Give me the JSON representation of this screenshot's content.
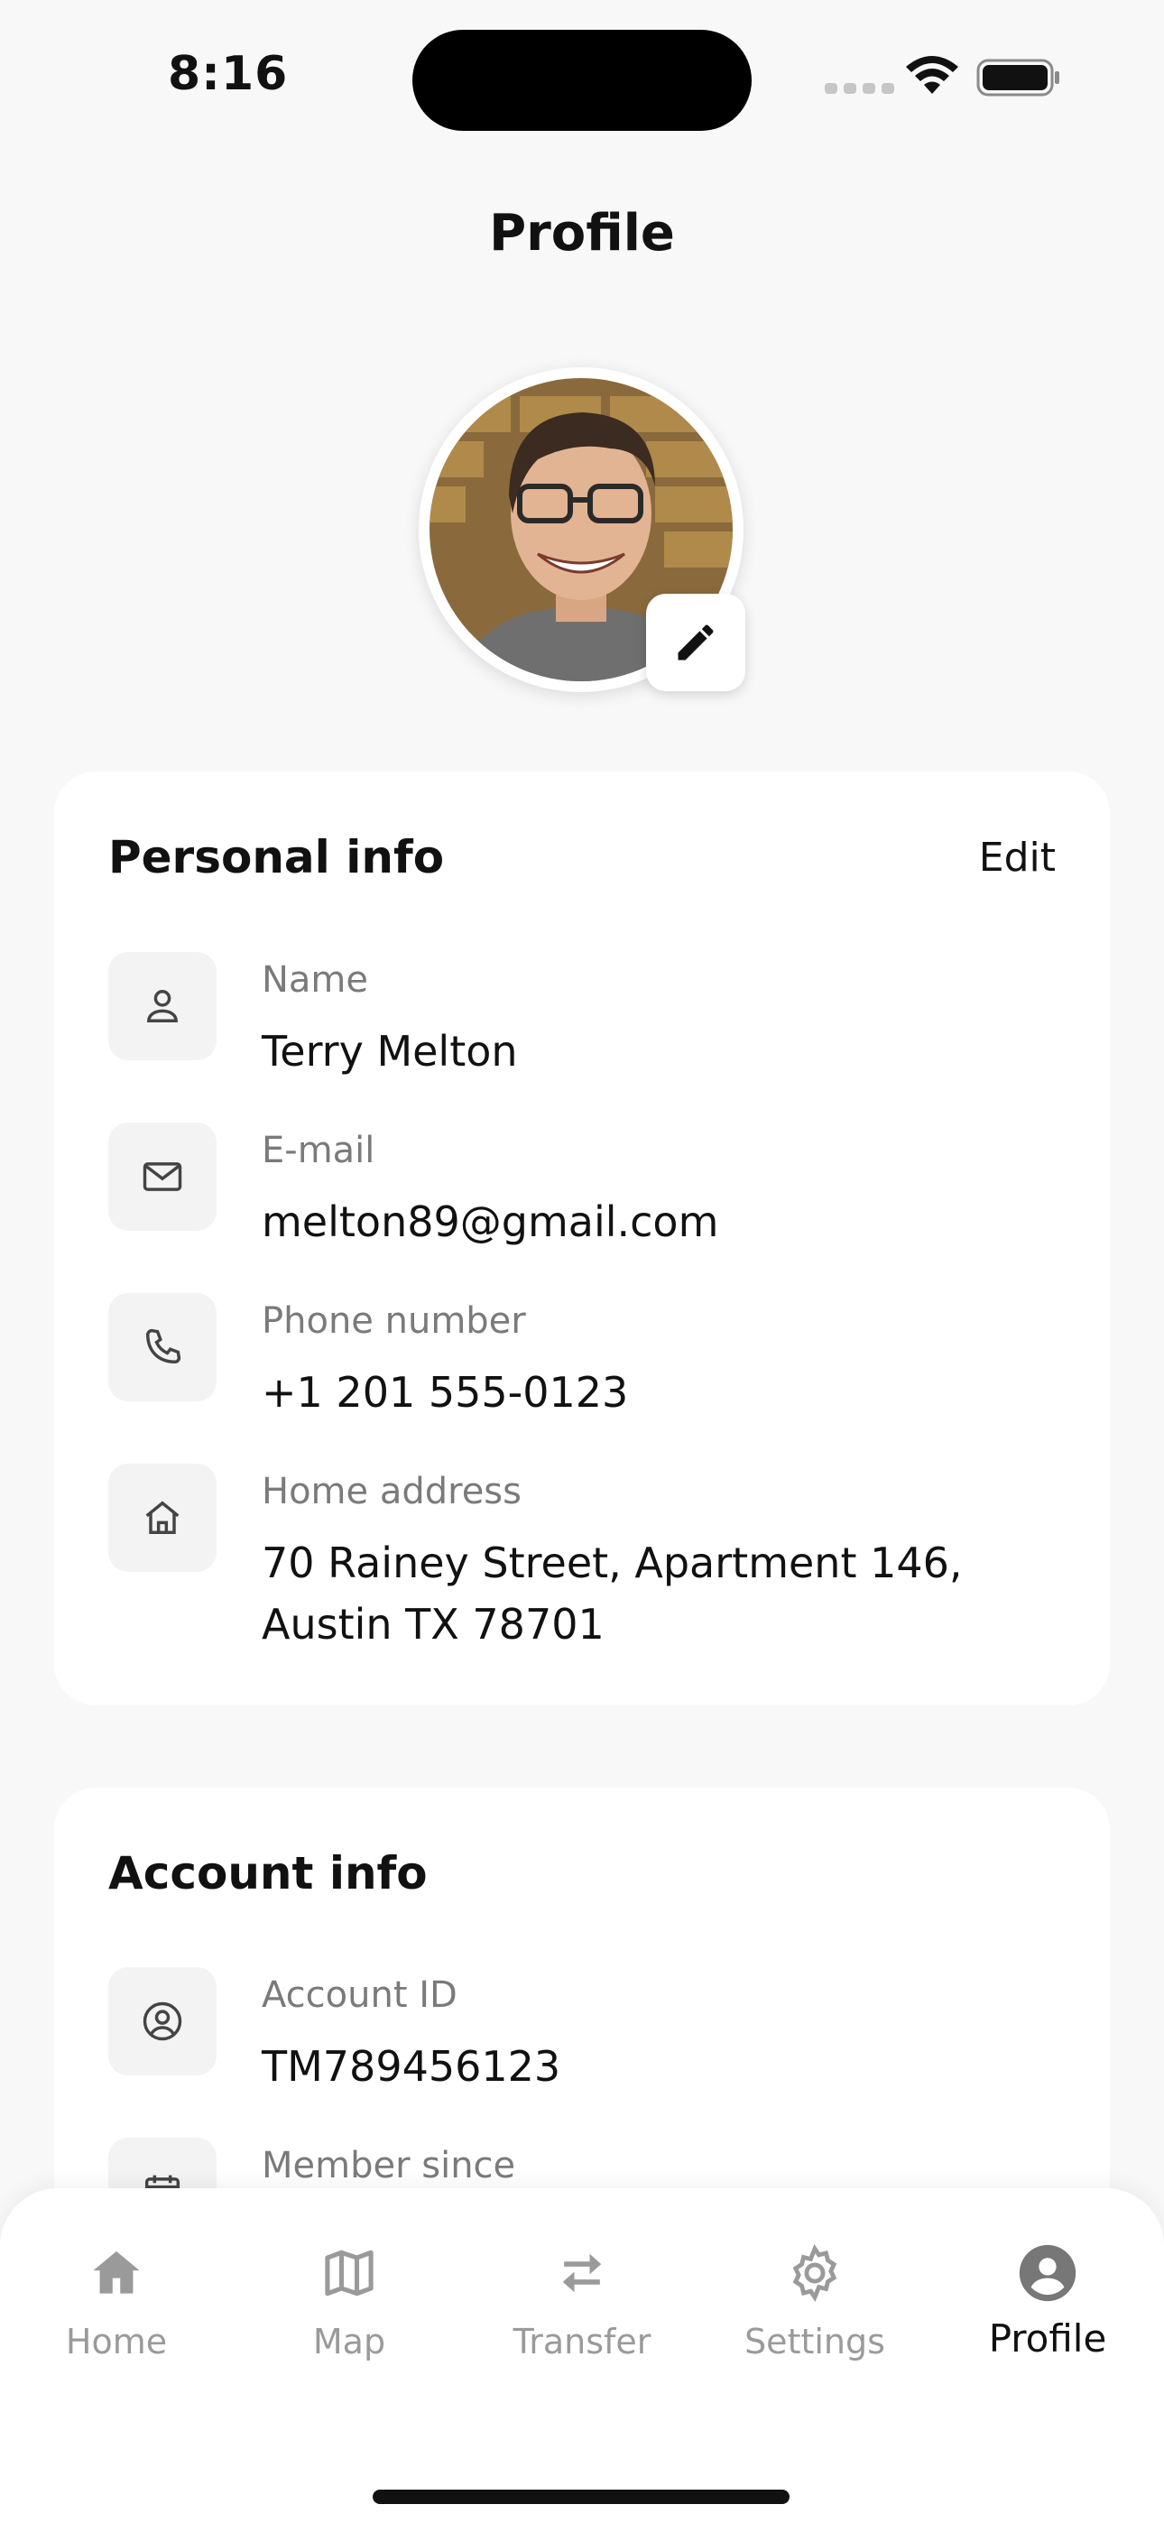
{
  "status_bar": {
    "time": "8:16"
  },
  "header": {
    "title": "Profile"
  },
  "avatar": {
    "alt": "Profile photo"
  },
  "personal_info": {
    "title": "Personal info",
    "edit_label": "Edit",
    "rows": [
      {
        "label": "Name",
        "value": "Terry Melton",
        "icon": "person-icon"
      },
      {
        "label": "E-mail",
        "value": "melton89@gmail.com",
        "icon": "mail-icon"
      },
      {
        "label": "Phone number",
        "value": "+1 201 555-0123",
        "icon": "phone-icon"
      },
      {
        "label": "Home address",
        "value": "70 Rainey Street, Apartment 146, Austin TX 78701",
        "icon": "home-icon"
      }
    ]
  },
  "account_info": {
    "title": "Account info",
    "rows": [
      {
        "label": "Account ID",
        "value": "TM789456123",
        "icon": "account-circle-icon"
      },
      {
        "label": "Member since",
        "value": "",
        "icon": "calendar-icon"
      }
    ]
  },
  "tabs": [
    {
      "label": "Home",
      "icon": "home-icon",
      "active": false
    },
    {
      "label": "Map",
      "icon": "map-icon",
      "active": false
    },
    {
      "label": "Transfer",
      "icon": "transfer-icon",
      "active": false
    },
    {
      "label": "Settings",
      "icon": "gear-icon",
      "active": false
    },
    {
      "label": "Profile",
      "icon": "profile-icon",
      "active": true
    }
  ],
  "colors": {
    "background": "#f8f8f8",
    "card": "#ffffff",
    "icon_tile": "#f3f3f3",
    "muted_text": "#7a7a7a",
    "inactive_tab": "#9a9a9a"
  }
}
